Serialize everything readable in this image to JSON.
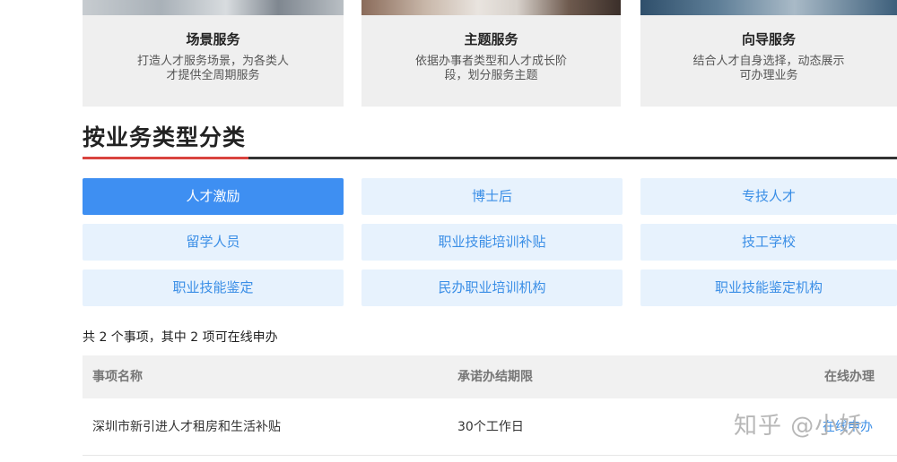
{
  "service_cards": [
    {
      "title": "场景服务",
      "desc_line1": "打造人才服务场景，为各类人",
      "desc_line2": "才提供全周期服务"
    },
    {
      "title": "主题服务",
      "desc_line1": "依据办事者类型和人才成长阶",
      "desc_line2": "段，划分服务主题"
    },
    {
      "title": "向导服务",
      "desc_line1": "结合人才自身选择，动态展示",
      "desc_line2": "可办理业务"
    }
  ],
  "section": {
    "title": "按业务类型分类",
    "accent_color": "#d9433f"
  },
  "categories": [
    {
      "label": "人才激励",
      "active": true
    },
    {
      "label": "博士后"
    },
    {
      "label": "专技人才"
    },
    {
      "label": "留学人员"
    },
    {
      "label": "职业技能培训补贴"
    },
    {
      "label": "技工学校"
    },
    {
      "label": "职业技能鉴定"
    },
    {
      "label": "民办职业培训机构"
    },
    {
      "label": "职业技能鉴定机构"
    }
  ],
  "summary": "共 2 个事项，其中 2 项可在线申办",
  "table": {
    "headers": [
      "事项名称",
      "承诺办结期限",
      "在线办理"
    ],
    "rows": [
      {
        "name": "深圳市新引进人才租房和生活补贴",
        "deadline": "30个工作日",
        "action": "在线申办"
      }
    ]
  },
  "watermark": "知乎 @小妖",
  "colors": {
    "active_bg": "#3e8ff2",
    "category_bg": "#e7f2fd",
    "category_text": "#3a8ee6"
  }
}
